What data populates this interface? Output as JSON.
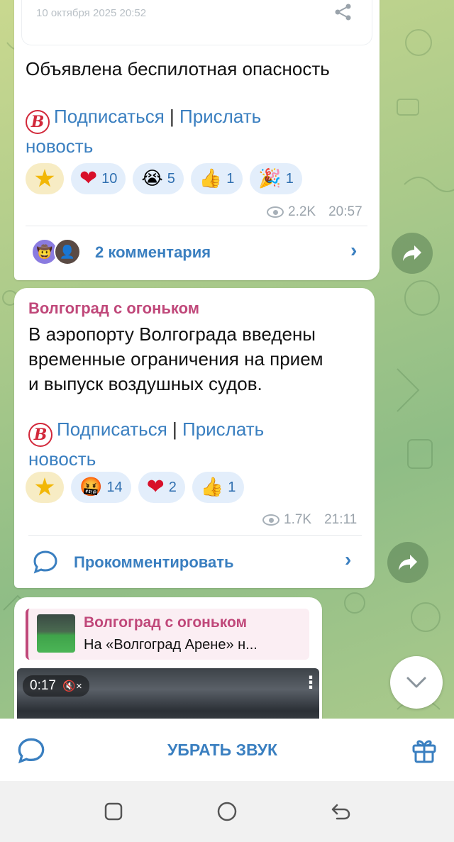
{
  "colors": {
    "accent": "#3a7fc0",
    "channel_name": "#c0487a",
    "bubble": "#ffffff",
    "meta": "#9aa3ab"
  },
  "post1": {
    "date_header": "10 октября 2025 20:52",
    "text": "Объявлена беспилотная опасность",
    "subscribe": "Подписаться",
    "separator": "|",
    "send_news_1": "Прислать",
    "send_news_2": "новость",
    "reactions": [
      {
        "icon": "star-icon",
        "count": ""
      },
      {
        "icon": "heart-icon",
        "emoji": "❤",
        "count": "10"
      },
      {
        "icon": "crying-face-icon",
        "emoji": "😭",
        "count": "5"
      },
      {
        "icon": "thumbs-up-icon",
        "emoji": "👍",
        "count": "1"
      },
      {
        "icon": "party-popper-icon",
        "emoji": "🎉",
        "count": "1"
      }
    ],
    "views": "2.2K",
    "time": "20:57",
    "comments": "2 комментария"
  },
  "post2": {
    "channel": "Волгоград с огоньком",
    "text_lines": [
      "В аэропорту Волгограда введены",
      "временные ограничения на прием",
      "и выпуск воздушных судов."
    ],
    "subscribe": "Подписаться",
    "separator": "|",
    "send_news_1": "Прислать",
    "send_news_2": "новость",
    "reactions": [
      {
        "icon": "star-icon",
        "count": ""
      },
      {
        "icon": "swearing-face-icon",
        "emoji": "🤬",
        "count": "14"
      },
      {
        "icon": "heart-icon",
        "emoji": "❤",
        "count": "2"
      },
      {
        "icon": "thumbs-up-icon",
        "emoji": "👍",
        "count": "1"
      }
    ],
    "views": "1.7K",
    "time": "21:11",
    "comment_action": "Прокомментировать"
  },
  "post3": {
    "reply_channel": "Волгоград с огоньком",
    "reply_text": "На «Волгоград Арене» н...",
    "video_duration": "0:17",
    "mute_glyph": "🔇×"
  },
  "bottom_bar": {
    "mute_label": "УБРАТЬ ЗВУК"
  }
}
